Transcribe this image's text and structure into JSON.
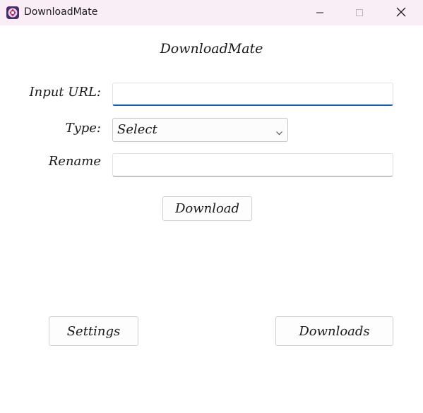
{
  "window": {
    "title": "DownloadMate",
    "icon": "downloadmate-app-icon",
    "controls": [
      "minimize-icon",
      "maximize-icon",
      "close-icon"
    ]
  },
  "app": {
    "heading": "DownloadMate"
  },
  "form": {
    "url_label": "Input URL:",
    "url_value": "",
    "type_label": "Type:",
    "type_selected": "Select",
    "rename_label": "Rename",
    "rename_value": ""
  },
  "buttons": {
    "download": "Download",
    "settings": "Settings",
    "downloads": "Downloads"
  },
  "colors": {
    "titlebar": "#f9eef5",
    "focus_underline": "#1162b8"
  }
}
